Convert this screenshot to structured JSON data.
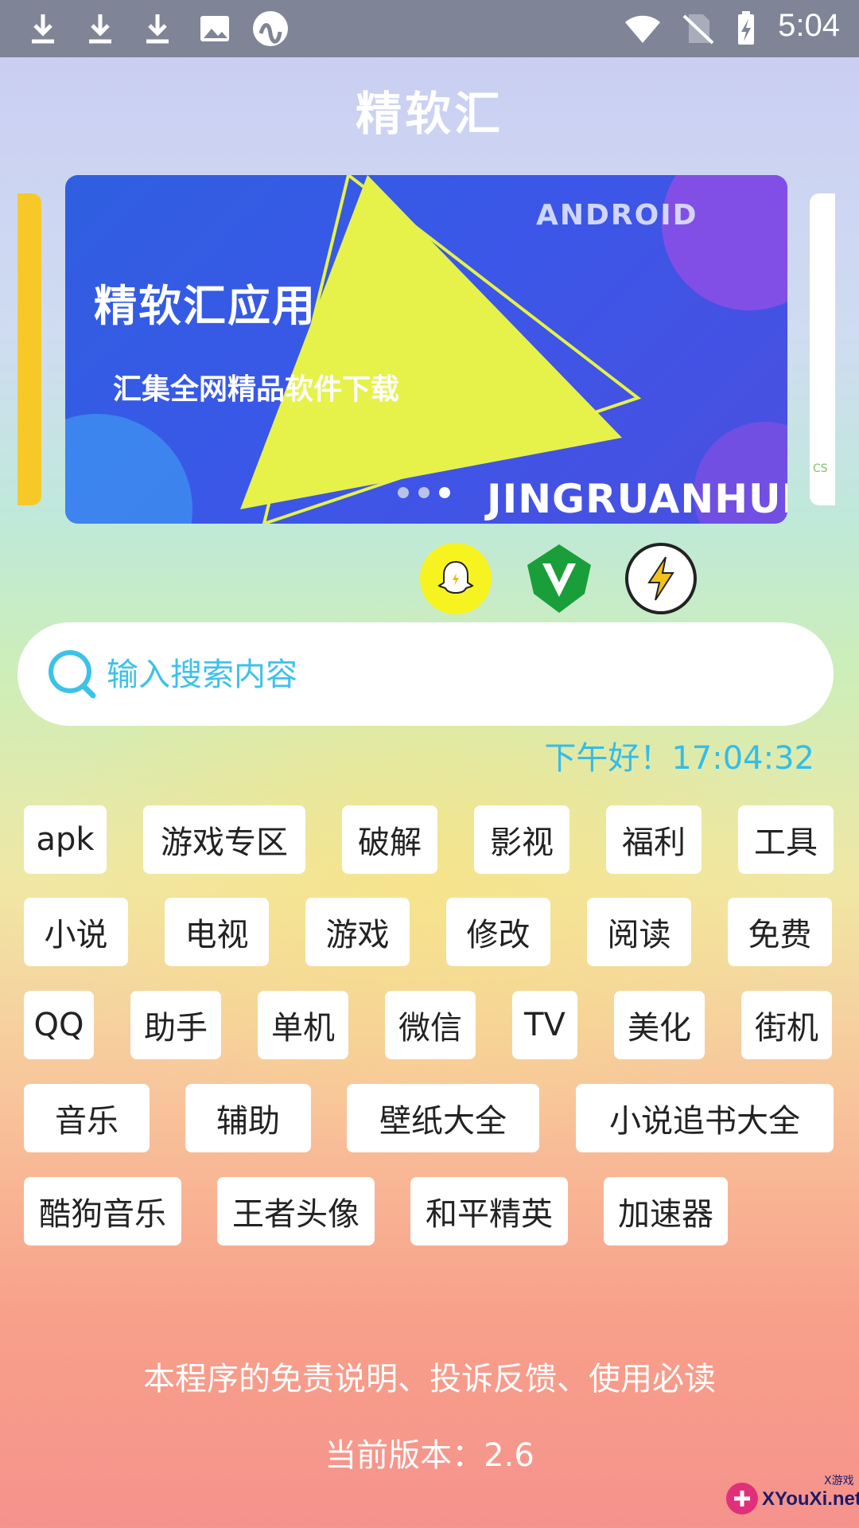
{
  "status_bar": {
    "time": "5:04",
    "left_icons": [
      "download-icon",
      "download-icon",
      "download-icon",
      "image-icon",
      "app-icon"
    ],
    "right_icons": [
      "wifi-icon",
      "no-sim-icon",
      "battery-charging-icon"
    ]
  },
  "app": {
    "title": "精软汇"
  },
  "banner": {
    "title": "精软汇应用",
    "subtitle": "汇集全网精品软件下载",
    "android_label": "ANDROID",
    "brand": "JINGRUANHUI",
    "page_count": 3,
    "active_index": 2
  },
  "shortcuts": [
    {
      "icon": "ghost-icon",
      "color": "#f7f320"
    },
    {
      "icon": "v-icon",
      "color": "#1a9e3a"
    },
    {
      "icon": "lightning-icon",
      "color": "#f2c21b"
    }
  ],
  "search": {
    "placeholder": "输入搜索内容"
  },
  "greeting": "下午好！17:04:32",
  "tags": [
    [
      "apk",
      "游戏专区",
      "破解",
      "影视",
      "福利",
      "工具"
    ],
    [
      "小说",
      "电视",
      "游戏",
      "修改",
      "阅读",
      "免费"
    ],
    [
      "QQ",
      "助手",
      "单机",
      "微信",
      "TV",
      "美化",
      "街机"
    ],
    [
      "音乐",
      "辅助",
      "壁纸大全",
      "小说追书大全"
    ],
    [
      "酷狗音乐",
      "王者头像",
      "和平精英",
      "加速器"
    ]
  ],
  "footer": {
    "disclaimer": "本程序的免责说明、投诉反馈、使用必读",
    "version": "当前版本：2.6"
  },
  "watermark": {
    "text": "XYouXi.net",
    "cn": "X游戏"
  },
  "colors": {
    "accent": "#3cc2e9",
    "banner_bg": "#3a57e8",
    "triangle": "#e6f24a"
  }
}
